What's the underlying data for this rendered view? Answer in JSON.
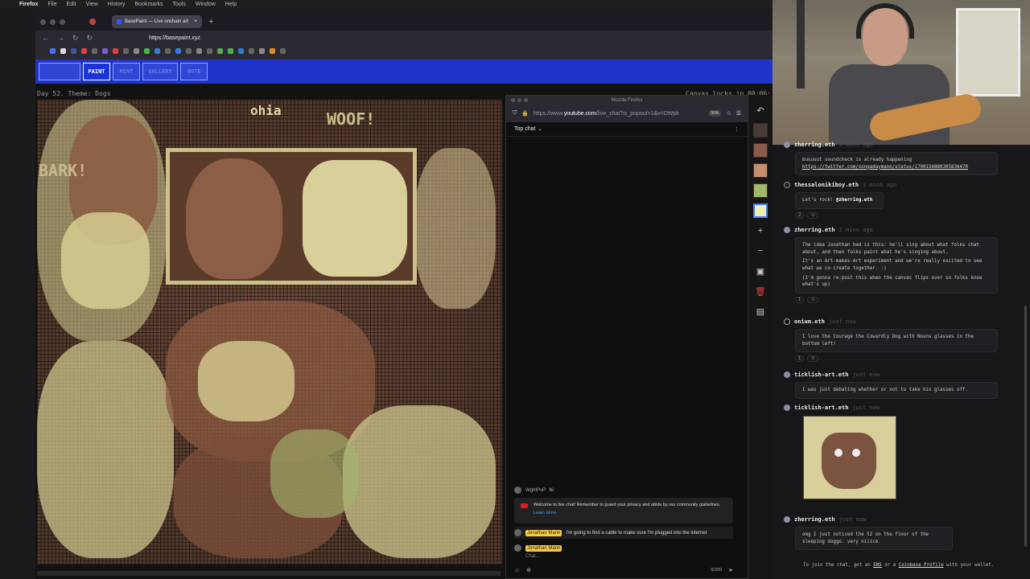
{
  "menubar": {
    "apple": "",
    "app": "Firefox",
    "items": [
      "File",
      "Edit",
      "View",
      "History",
      "Bookmarks",
      "Tools",
      "Window",
      "Help"
    ]
  },
  "browser": {
    "tab_title": "BasePaint — Live onchain art",
    "url": "https://basepaint.xyz",
    "new_tab": "+",
    "tab_close": "×"
  },
  "basepaint": {
    "nav": [
      {
        "label": "",
        "active": false
      },
      {
        "label": "PAINT",
        "active": true
      },
      {
        "label": "MINT",
        "active": false
      },
      {
        "label": "GALLERY",
        "active": false
      },
      {
        "label": "VOTE",
        "active": false
      }
    ],
    "day_theme": "Day 52. Theme: Dogs",
    "canvas_status": "Canvas locks in 00:06:",
    "canvas_text_top": "ohia",
    "canvas_text_woof": "WOOF!",
    "canvas_text_bark": "BARK!"
  },
  "popup": {
    "window_title": "Mozilla Firefox",
    "url_prefix": "https://www.",
    "url_domain": "youtube.com",
    "url_rest": "/live_chat?is_popout=1&v=DWpk",
    "zoom": "90%",
    "chat_mode": "Top chat",
    "messages": [
      {
        "author": "WghtPvP",
        "text": "hi",
        "highlight": false
      },
      {
        "author": "Jonathan Mann",
        "text": "I'm going to find a cable to make sure I'm plugged into the internet",
        "highlight": true
      }
    ],
    "notice_text": "Welcome to live chat! Remember to guard your privacy and abide by our community guidelines.",
    "notice_link": "Learn more",
    "input_author": "Jonathan Mann",
    "input_placeholder": "Chat...",
    "char_count": "0/200"
  },
  "palette": {
    "colors": [
      "#4a3a34",
      "#8c5a48",
      "#c58e6b",
      "#9fb86a",
      "#f3eeb2"
    ],
    "selected_index": 4
  },
  "tools": [
    "plus-icon",
    "minus-icon",
    "image-icon",
    "trash-icon",
    "save-icon"
  ],
  "bp_chat": {
    "messages": [
      {
        "author": "zherring.eth",
        "time": "5 mins ago",
        "paragraphs": [
          "buuuuut soundcheck is already happening"
        ],
        "link": "https://twitter.com/songadaymann/status/1700156880305836470",
        "reactions": []
      },
      {
        "author": "thessalonikiboy.eth",
        "time": "3 mins ago",
        "paragraphs": [
          "Let's rock!"
        ],
        "mention": "@zherring.eth",
        "reactions": [
          "2"
        ]
      },
      {
        "author": "zherring.eth",
        "time": "2 mins ago",
        "paragraphs": [
          "The idea Jonathan had is this: he'll sing about what folks chat about, and then folks paint what he's singing about.",
          "It's an Art-makes-Art experiment and we're really excited to see what we co-create together. :)",
          "(I'm gonna re-post this when the canvas flips over so folks know what's up)"
        ],
        "reactions": [
          "1"
        ]
      },
      {
        "author": "onium.eth",
        "time": "just now",
        "paragraphs": [
          "I love the Courage the Cowardly Dog with Nouns glasses in the bottom left!"
        ],
        "reactions": [
          "1"
        ]
      },
      {
        "author": "ticklish-art.eth",
        "time": "just now",
        "paragraphs": [
          "I was just debating whether or not to take his glasses off."
        ],
        "reactions": []
      },
      {
        "author": "ticklish-art.eth",
        "time": "just now",
        "paragraphs": [],
        "reactions": []
      },
      {
        "author": "zherring.eth",
        "time": "just now",
        "paragraphs": [
          "omg I just noticed the 52 on the floor of the sleeping doggo. very niiice."
        ],
        "reactions": []
      }
    ],
    "footer_pre": "To join the chat, get an",
    "footer_ens": "ENS",
    "footer_mid": "or a",
    "footer_cb": "Coinbase Profile",
    "footer_post": "with your wallet."
  }
}
